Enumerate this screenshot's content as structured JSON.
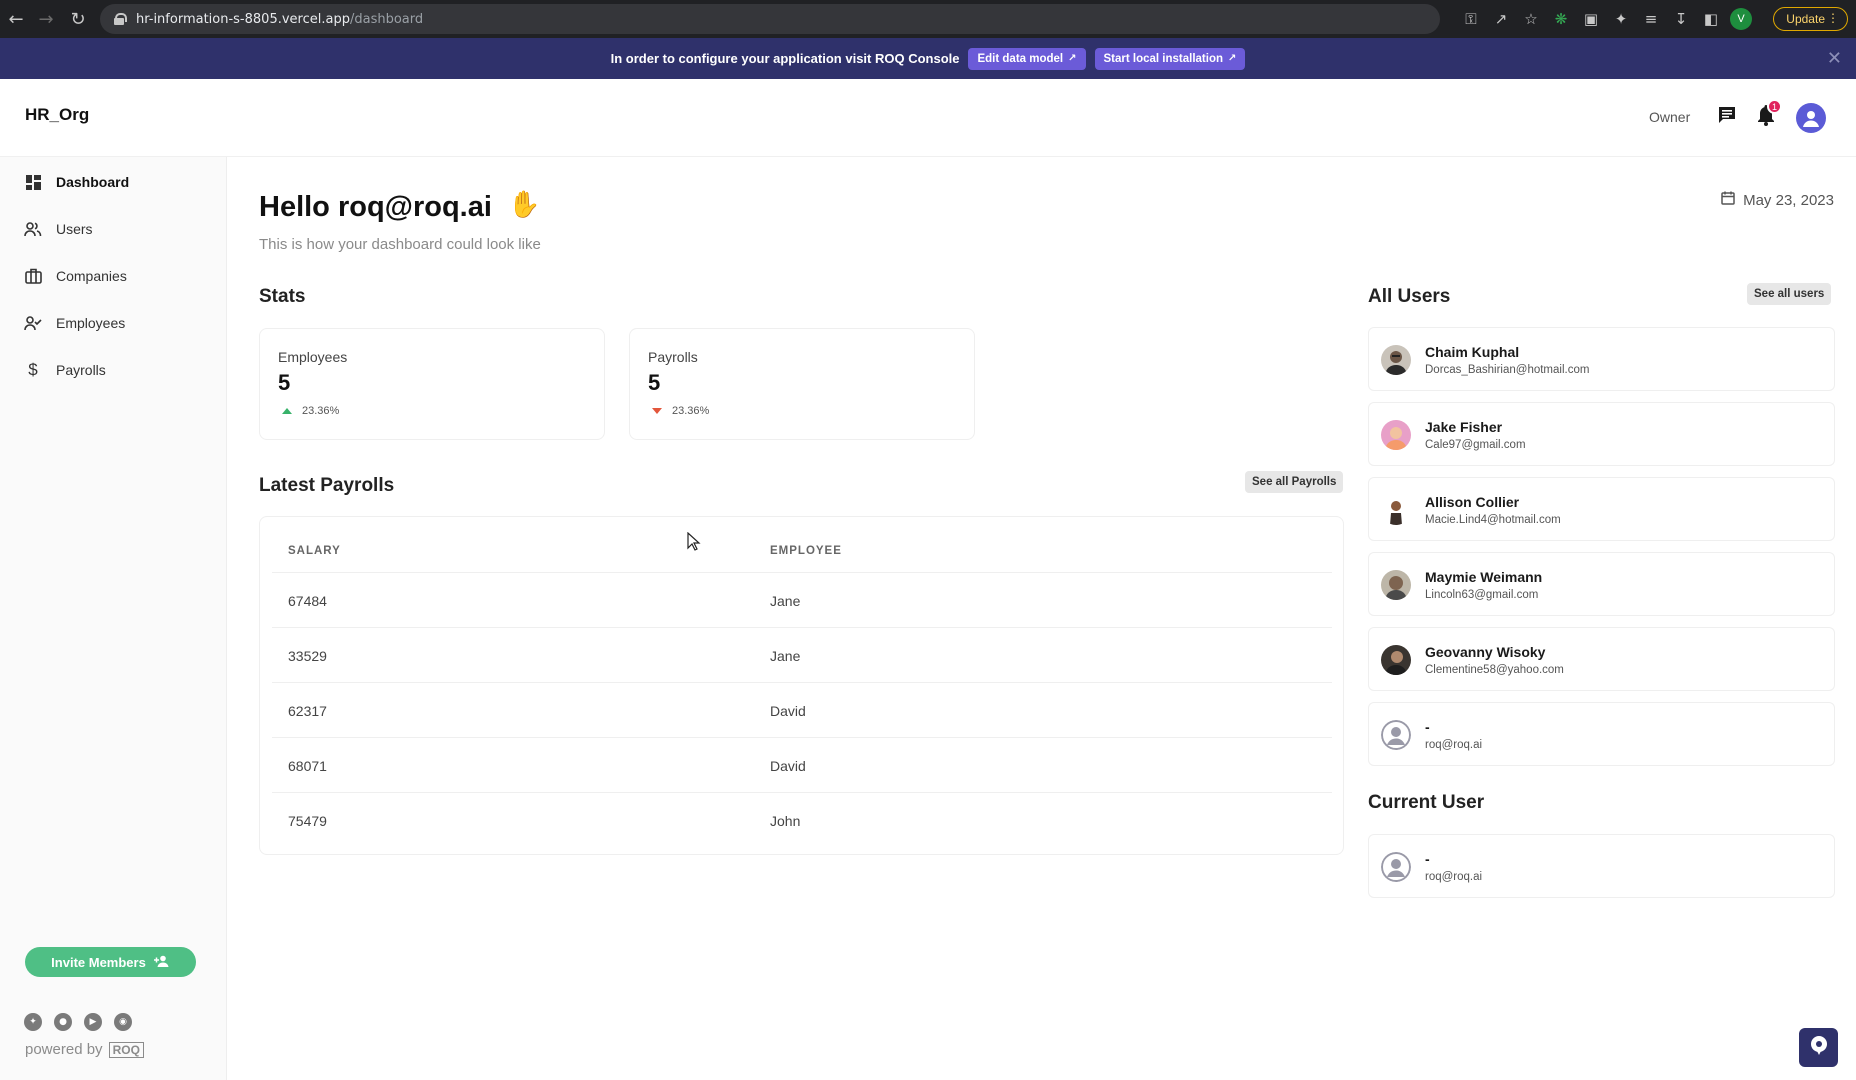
{
  "browser": {
    "url_host": "hr-information-s-8805.vercel.app",
    "url_path": "/dashboard",
    "profile_initial": "V",
    "update_label": "Update"
  },
  "banner": {
    "text": "In order to configure your application visit ROQ Console",
    "edit_label": "Edit data model",
    "install_label": "Start local installation",
    "close_icon": "close-icon"
  },
  "header": {
    "brand": "HR_Org",
    "role": "Owner",
    "notification_count": "1"
  },
  "sidebar": {
    "items": [
      {
        "label": "Dashboard",
        "icon": "dashboard-icon",
        "active": true
      },
      {
        "label": "Users",
        "icon": "users-icon",
        "active": false
      },
      {
        "label": "Companies",
        "icon": "companies-icon",
        "active": false
      },
      {
        "label": "Employees",
        "icon": "employees-icon",
        "active": false
      },
      {
        "label": "Payrolls",
        "icon": "dollar-icon",
        "active": false
      }
    ],
    "invite_label": "Invite Members",
    "powered_by": "powered by",
    "powered_logo": "ROQ"
  },
  "main": {
    "greeting": "Hello roq@roq.ai",
    "subtitle": "This is how your dashboard could look like",
    "date": "May 23, 2023",
    "stats_title": "Stats",
    "stats": [
      {
        "label": "Employees",
        "value": "5",
        "change": "23.36%",
        "direction": "up"
      },
      {
        "label": "Payrolls",
        "value": "5",
        "change": "23.36%",
        "direction": "down"
      }
    ],
    "payrolls_title": "Latest Payrolls",
    "see_all_payrolls": "See all Payrolls",
    "columns": [
      "SALARY",
      "EMPLOYEE"
    ],
    "rows": [
      {
        "salary": "67484",
        "employee": "Jane"
      },
      {
        "salary": "33529",
        "employee": "Jane"
      },
      {
        "salary": "62317",
        "employee": "David"
      },
      {
        "salary": "68071",
        "employee": "David"
      },
      {
        "salary": "75479",
        "employee": "John"
      }
    ]
  },
  "users": {
    "title": "All Users",
    "see_all": "See all users",
    "list": [
      {
        "name": "Chaim Kuphal",
        "email": "Dorcas_Bashirian@hotmail.com"
      },
      {
        "name": "Jake Fisher",
        "email": "Cale97@gmail.com"
      },
      {
        "name": "Allison Collier",
        "email": "Macie.Lind4@hotmail.com"
      },
      {
        "name": "Maymie Weimann",
        "email": "Lincoln63@gmail.com"
      },
      {
        "name": "Geovanny Wisoky",
        "email": "Clementine58@yahoo.com"
      },
      {
        "name": "-",
        "email": "roq@roq.ai"
      }
    ],
    "current_title": "Current User",
    "current": {
      "name": "-",
      "email": "roq@roq.ai"
    }
  },
  "colors": {
    "banner_bg": "#2f316b",
    "accent": "#5b5bd6",
    "invite_green": "#4fbf85",
    "up_green": "#38b26a",
    "down_red": "#e3563b"
  }
}
